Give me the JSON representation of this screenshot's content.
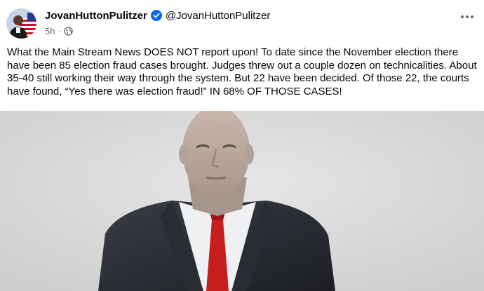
{
  "post": {
    "author_name": "JovanHuttonPulitzer",
    "author_handle": "@JovanHuttonPulitzer",
    "timestamp": "5h",
    "separator": "·",
    "body": "What the Main Stream News DOES NOT report upon! To date since the November election there have been 85 election fraud cases brought. Judges threw out a couple dozen on technicalities. About 35-40 still working their way through the system. But 22 have been decided. Of those 22, the courts have found, “Yes there was election fraud!” IN 68% OF THOSE CASES!"
  },
  "icons": {
    "verified": "verified-badge-icon",
    "audience": "public-audience-icon",
    "more": "more-options-icon"
  },
  "colors": {
    "verified_blue": "#0866ff",
    "meta_gray": "#65676b",
    "text": "#050505"
  }
}
